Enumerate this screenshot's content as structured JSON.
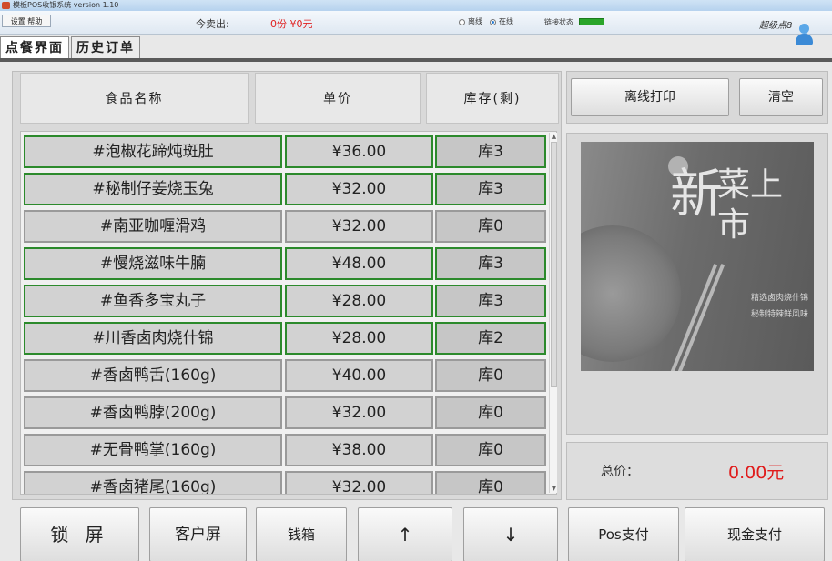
{
  "window": {
    "title": "模板POS收银系统 version 1.10"
  },
  "statusbar": {
    "menu_label": "设置  帮助",
    "sold_label": "今卖出:",
    "sold_value": "0份 ¥0元",
    "offline_label": "离线",
    "online_label": "在线",
    "mode_selected": "online",
    "connection_label": "链接状态",
    "connection_color": "#2aa52a",
    "user_name": "超级点8",
    "user_icon": "user-avatar-icon"
  },
  "tabs": [
    {
      "label": "点餐界面",
      "active": true
    },
    {
      "label": "历史订单",
      "active": false
    }
  ],
  "table": {
    "columns": [
      "食品名称",
      "单价",
      "库存(剩)"
    ],
    "rows": [
      {
        "name": "#泡椒花蹄炖斑肚",
        "price": "¥36.00",
        "stock": "库3",
        "available": true
      },
      {
        "name": "#秘制仔姜烧玉兔",
        "price": "¥32.00",
        "stock": "库3",
        "available": true
      },
      {
        "name": "#南亚咖喱滑鸡",
        "price": "¥32.00",
        "stock": "库0",
        "available": false
      },
      {
        "name": "#慢烧滋味牛腩",
        "price": "¥48.00",
        "stock": "库3",
        "available": true
      },
      {
        "name": "#鱼香多宝丸子",
        "price": "¥28.00",
        "stock": "库3",
        "available": true
      },
      {
        "name": "#川香卤肉烧什锦",
        "price": "¥28.00",
        "stock": "库2",
        "available": true
      },
      {
        "name": "#香卤鸭舌(160g)",
        "price": "¥40.00",
        "stock": "库0",
        "available": false
      },
      {
        "name": "#香卤鸭脖(200g)",
        "price": "¥32.00",
        "stock": "库0",
        "available": false
      },
      {
        "name": "#无骨鸭掌(160g)",
        "price": "¥38.00",
        "stock": "库0",
        "available": false
      },
      {
        "name": "#香卤猪尾(160g)",
        "price": "¥32.00",
        "stock": "库0",
        "available": false
      }
    ]
  },
  "actions": {
    "offline_print": "离线打印",
    "clear": "清空"
  },
  "banner": {
    "stamp": "初",
    "title_char": "新",
    "title_rest": "菜上市",
    "line1": "精选卤肉烧什锦",
    "line2": "秘制特辣鲜风味"
  },
  "total": {
    "label": "总价：",
    "value": "0.00元"
  },
  "bottom": {
    "lock_screen": "锁 屏",
    "customer_screen": "客户屏",
    "cash_drawer": "钱箱",
    "up": "↑",
    "down": "↓",
    "pos_pay": "Pos支付",
    "cash_pay": "现金支付"
  }
}
